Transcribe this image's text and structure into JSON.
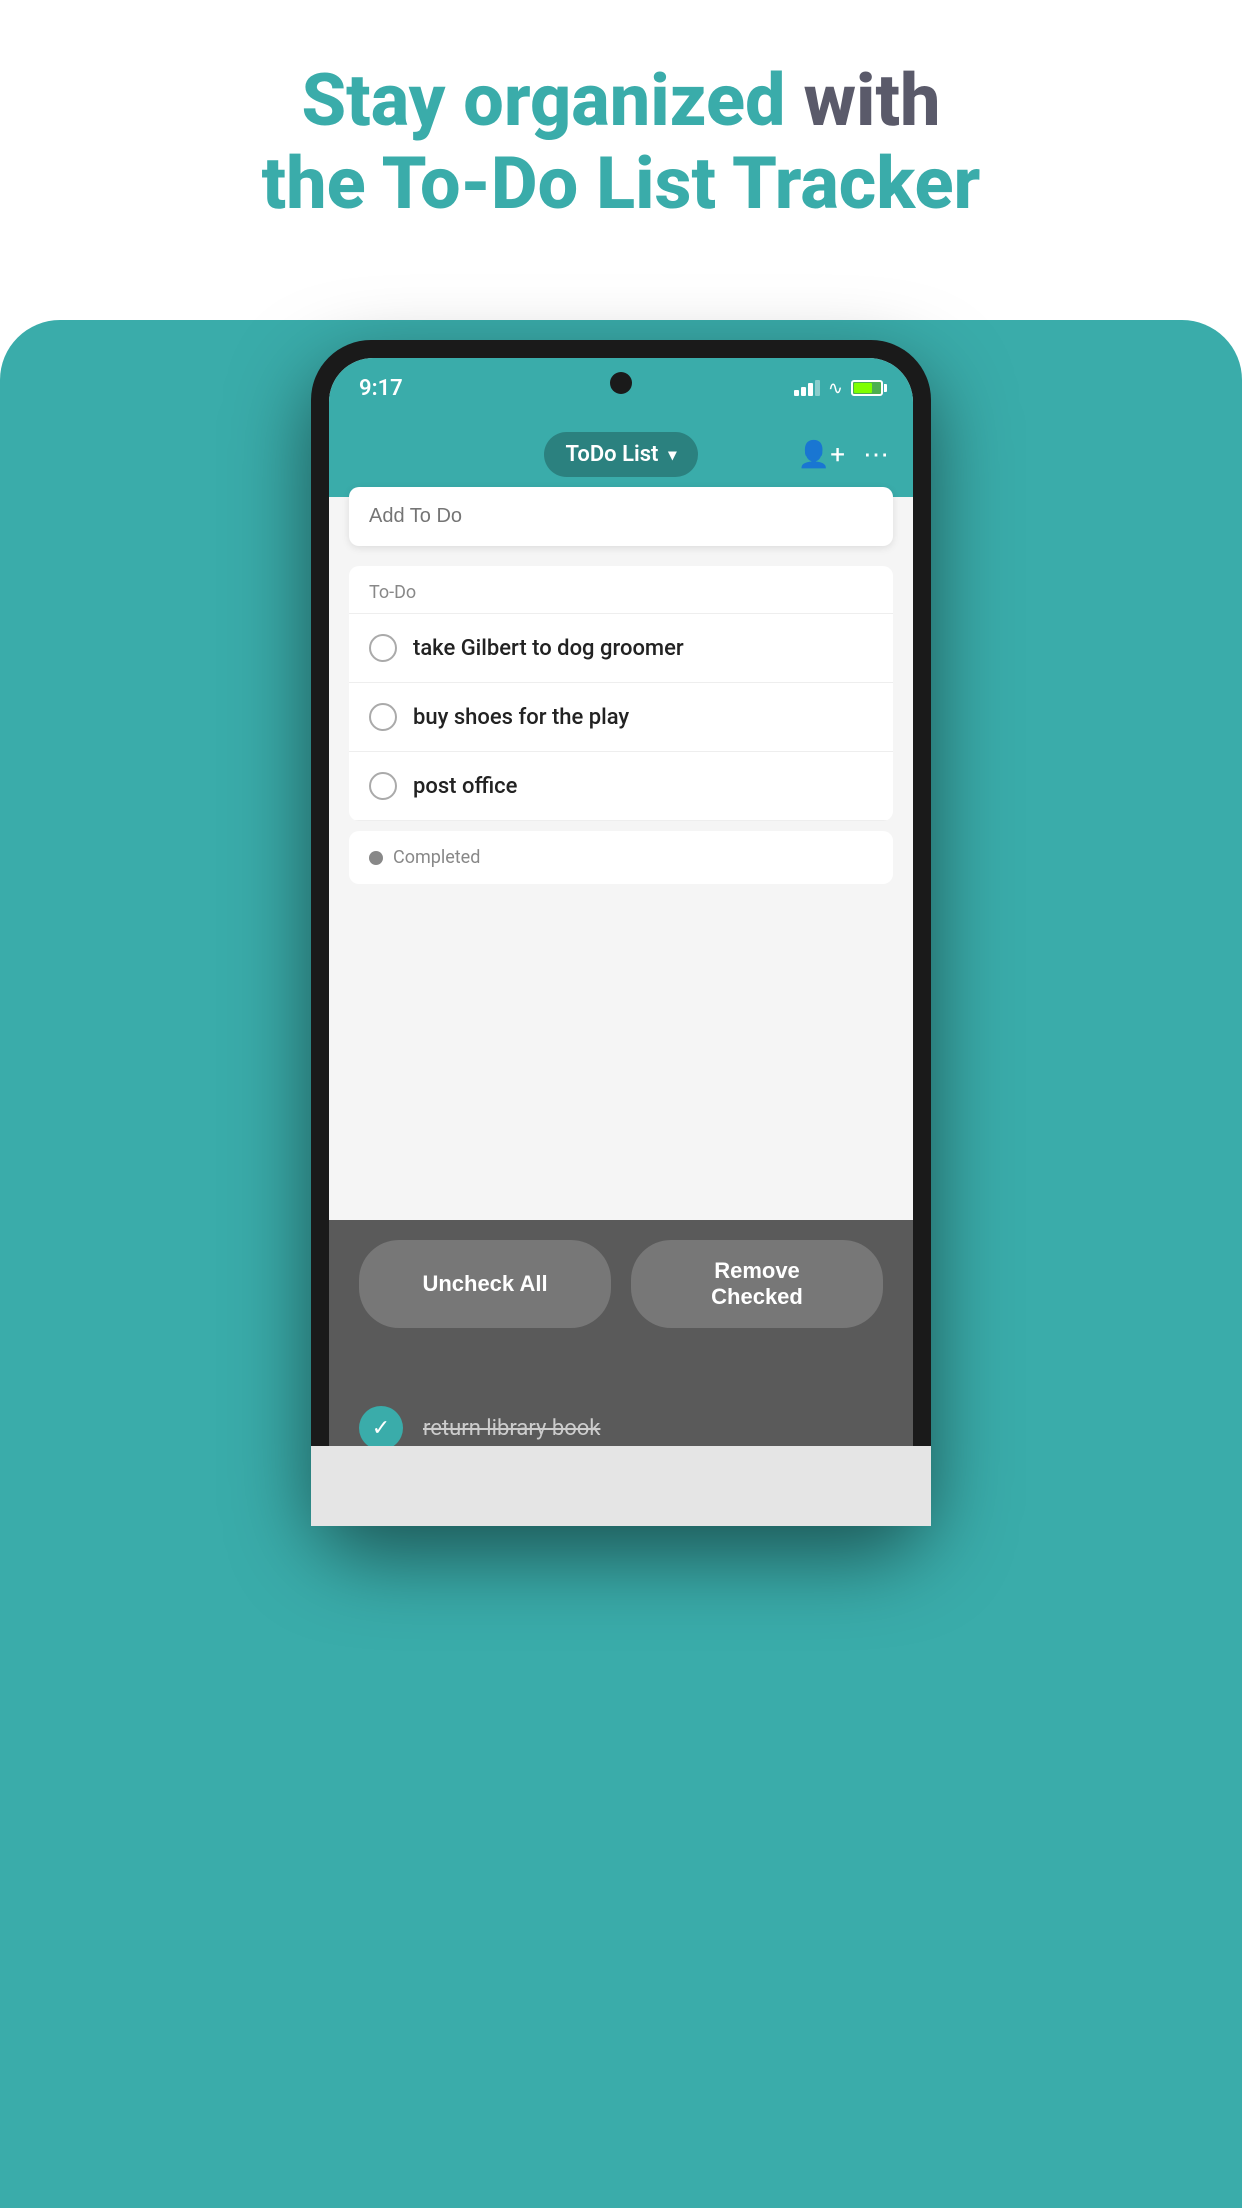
{
  "page": {
    "background_color": "#ffffff",
    "teal_color": "#3aacaa"
  },
  "header": {
    "line1_gray": "Stay organized",
    "line1_teal": "with",
    "line2_teal": "the To-Do List Tracker"
  },
  "status_bar": {
    "time": "9:17"
  },
  "app_header": {
    "title": "ToDo List",
    "add_placeholder": "Add To Do"
  },
  "todo_section": {
    "label": "To-Do",
    "items": [
      {
        "id": 1,
        "text": "take Gilbert to dog groomer",
        "checked": false
      },
      {
        "id": 2,
        "text": "buy shoes for the play",
        "checked": false
      },
      {
        "id": 3,
        "text": "post office",
        "checked": false
      }
    ]
  },
  "completed_section": {
    "label": "Completed",
    "items": [
      {
        "id": 4,
        "text": "return library book",
        "checked": true
      }
    ]
  },
  "bottom_bar": {
    "uncheck_all_label": "Uncheck All",
    "remove_checked_label": "Remove Checked"
  }
}
